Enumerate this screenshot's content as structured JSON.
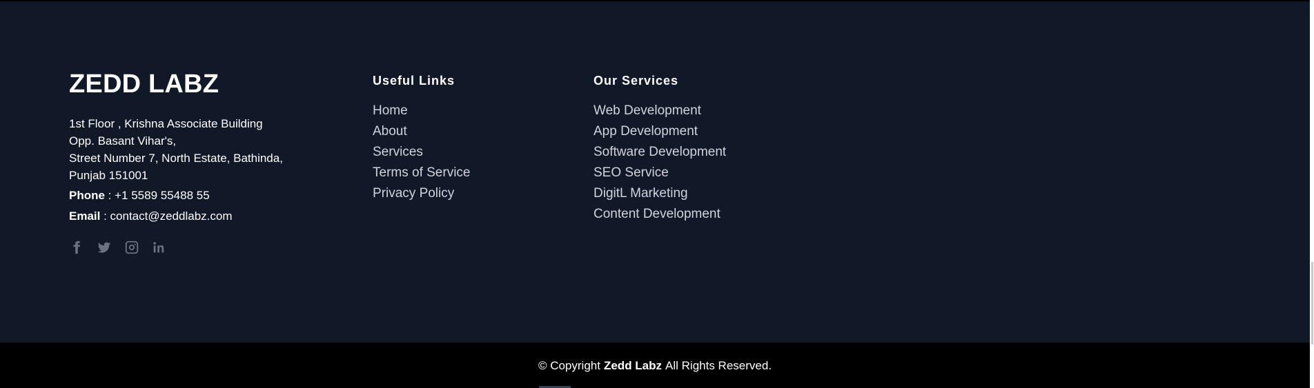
{
  "brand": {
    "title": "ZEDD LABZ",
    "address_lines": [
      "1st Floor , Krishna Associate Building",
      "Opp. Basant Vihar's,",
      "Street Number 7, North Estate, Bathinda,",
      "Punjab 151001"
    ],
    "phone_label": "Phone",
    "phone_separator": " : ",
    "phone_value": "+1 5589 55488 55",
    "email_label": "Email",
    "email_separator": " : ",
    "email_value": "contact@zeddlabz.com"
  },
  "socials": [
    {
      "icon": "facebook-icon"
    },
    {
      "icon": "twitter-icon"
    },
    {
      "icon": "instagram-icon"
    },
    {
      "icon": "linkedin-icon"
    }
  ],
  "useful_links": {
    "title": "Useful Links",
    "items": [
      "Home",
      "About",
      "Services",
      "Terms of Service",
      "Privacy Policy"
    ]
  },
  "our_services": {
    "title": "Our Services",
    "items": [
      "Web Development",
      "App Development",
      "Software Development",
      "SEO Service",
      "DigitL Marketing",
      "Content Development"
    ]
  },
  "bottom": {
    "prefix": "© Copyright",
    "name": "Zedd Labz",
    "suffix": "All Rights Reserved."
  },
  "colors": {
    "footer_bg": "#111827",
    "bottom_bg": "#000000",
    "text_white": "#ffffff",
    "link_text": "#d1d5db",
    "social_icon": "#6b7280"
  }
}
